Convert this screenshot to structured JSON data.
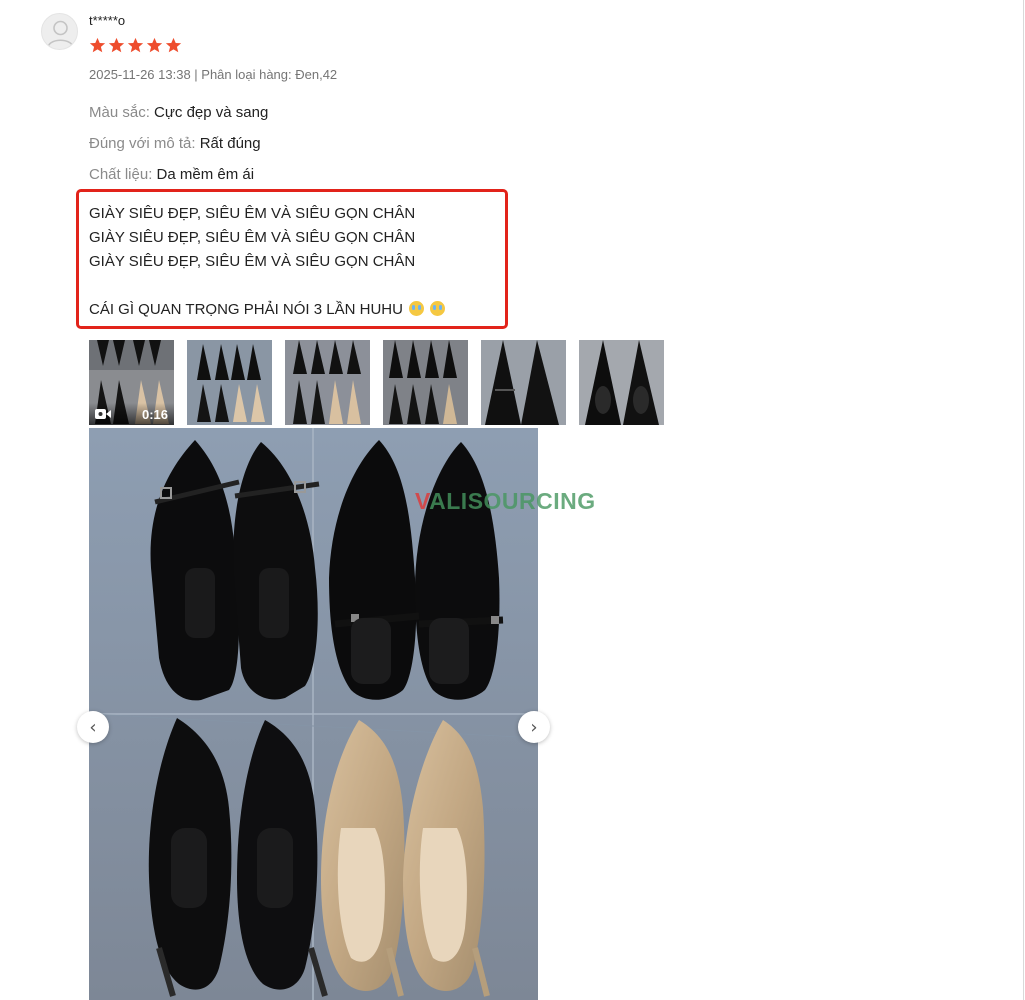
{
  "review": {
    "username": "t*****o",
    "rating": 5,
    "meta": "2025-11-26 13:38 | Phân loại hàng: Đen,42",
    "attributes": [
      {
        "key": "Màu sắc:",
        "value": "Cực đẹp và sang"
      },
      {
        "key": "Đúng với mô tả:",
        "value": "Rất đúng"
      },
      {
        "key": "Chất liệu:",
        "value": "Da mềm êm ái"
      }
    ],
    "text_lines": [
      "GIÀY SIÊU ĐẸP, SIÊU ÊM VÀ SIÊU GỌN CHÂN",
      "GIÀY SIÊU ĐẸP, SIÊU ÊM VÀ SIÊU GỌN CHÂN",
      "GIÀY SIÊU ĐẸP, SIÊU ÊM VÀ SIÊU GỌN CHÂN"
    ],
    "closing_line": "CÁI GÌ QUAN TRỌNG PHẢI NÓI 3 LẦN HUHU",
    "closing_emojis": [
      "crying-face",
      "crying-face"
    ]
  },
  "media": {
    "video_duration": "0:16",
    "thumbnail_count": 6,
    "active_thumbnail": 1,
    "prev_icon": "‹",
    "next_icon": "›"
  },
  "watermark": {
    "prefix": "V",
    "rest": "ALISOURCING"
  },
  "colors": {
    "star": "#ee4d2d",
    "highlight_border": "#e2231a",
    "active_thumb_border": "#ee4d2d"
  }
}
